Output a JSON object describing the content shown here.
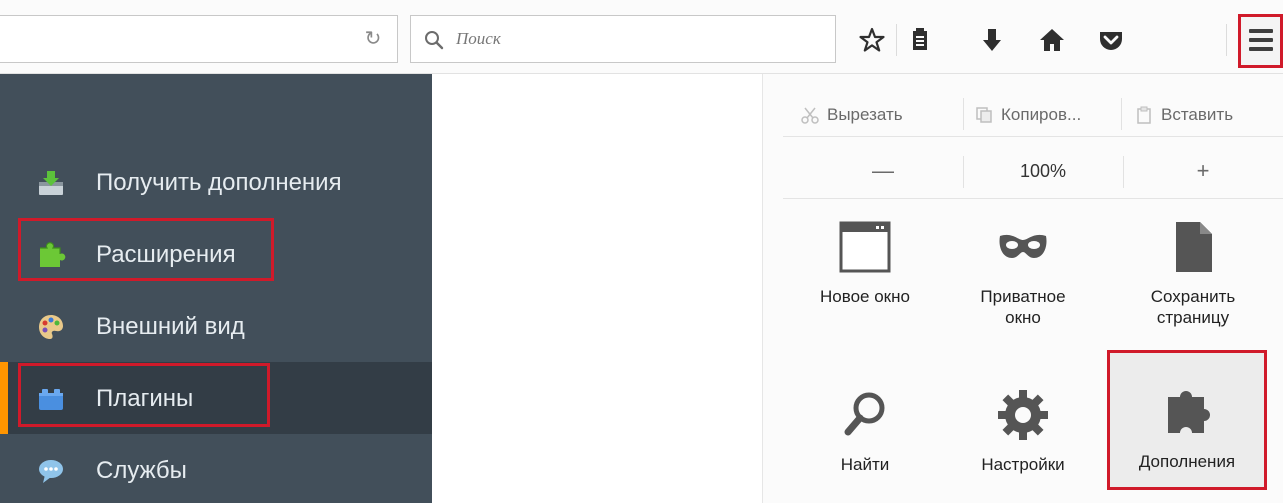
{
  "search": {
    "placeholder": "Поиск"
  },
  "sidebar": {
    "items": [
      {
        "label": "Получить дополнения"
      },
      {
        "label": "Расширения"
      },
      {
        "label": "Внешний вид"
      },
      {
        "label": "Плагины"
      },
      {
        "label": "Службы"
      }
    ]
  },
  "panel": {
    "edit": {
      "cut": "Вырезать",
      "copy": "Копиров...",
      "paste": "Вставить"
    },
    "zoom": {
      "minus": "—",
      "value": "100%",
      "plus": "+"
    },
    "tiles": [
      {
        "label": "Новое окно"
      },
      {
        "label": "Приватное\nокно"
      },
      {
        "label": "Сохранить\nстраницу"
      },
      {
        "label": "Найти"
      },
      {
        "label": "Настройки"
      },
      {
        "label": "Дополнения"
      }
    ]
  },
  "colors": {
    "sidebar_bg": "#424f5a",
    "selected_bg": "#333d46",
    "accent": "#ff9500",
    "highlight": "#d01a2a"
  }
}
